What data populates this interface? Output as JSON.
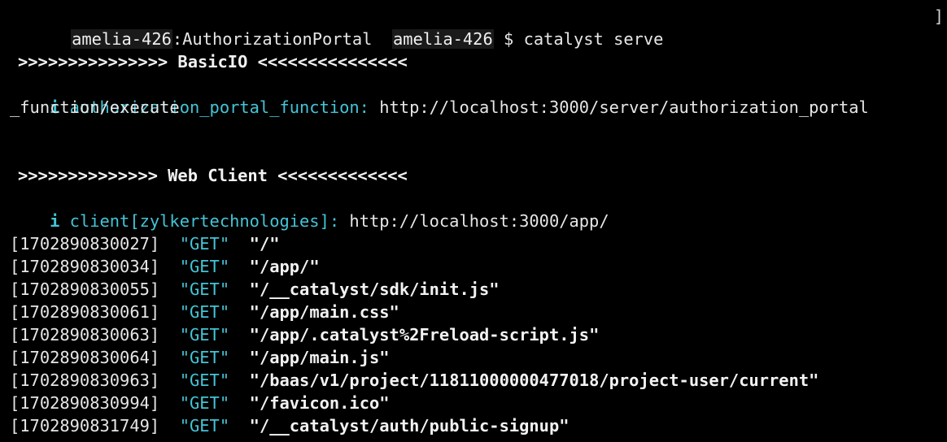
{
  "prompt": {
    "user_host": "amelia-426",
    "separator": ":",
    "directory": "AuthorizationPortal",
    "user_host_2": "amelia-426",
    "symbol": "$",
    "command": "catalyst serve",
    "cursor": "]"
  },
  "basicio": {
    "header": ">>>>>>>>>>>>>>> BasicIO <<<<<<<<<<<<<<<",
    "info_icon": "i",
    "function_name": "authorization_portal_function:",
    "url_part1": "http://localhost:3000/server/authorization_portal",
    "url_part2": "_function/execute"
  },
  "webclient": {
    "header": ">>>>>>>>>>>>>> Web Client <<<<<<<<<<<<<",
    "info_icon": "i",
    "client_name": "client[zylkertechnologies]:",
    "url": "http://localhost:3000/app/"
  },
  "requests": [
    {
      "ts": "[1702890830027]",
      "method": "\"GET\"",
      "path": "\"/\""
    },
    {
      "ts": "[1702890830034]",
      "method": "\"GET\"",
      "path": "\"/app/\""
    },
    {
      "ts": "[1702890830055]",
      "method": "\"GET\"",
      "path": "\"/__catalyst/sdk/init.js\""
    },
    {
      "ts": "[1702890830061]",
      "method": "\"GET\"",
      "path": "\"/app/main.css\""
    },
    {
      "ts": "[1702890830063]",
      "method": "\"GET\"",
      "path": "\"/app/.catalyst%2Freload-script.js\""
    },
    {
      "ts": "[1702890830064]",
      "method": "\"GET\"",
      "path": "\"/app/main.js\""
    },
    {
      "ts": "[1702890830963]",
      "method": "\"GET\"",
      "path": "\"/baas/v1/project/11811000000477018/project-user/current\""
    },
    {
      "ts": "[1702890830994]",
      "method": "\"GET\"",
      "path": "\"/favicon.ico\""
    },
    {
      "ts": "[1702890831749]",
      "method": "\"GET\"",
      "path": "\"/__catalyst/auth/public-signup\""
    }
  ],
  "colors": {
    "background": "#000000",
    "text": "#e6e6e6",
    "cyan": "#43c4d6"
  }
}
